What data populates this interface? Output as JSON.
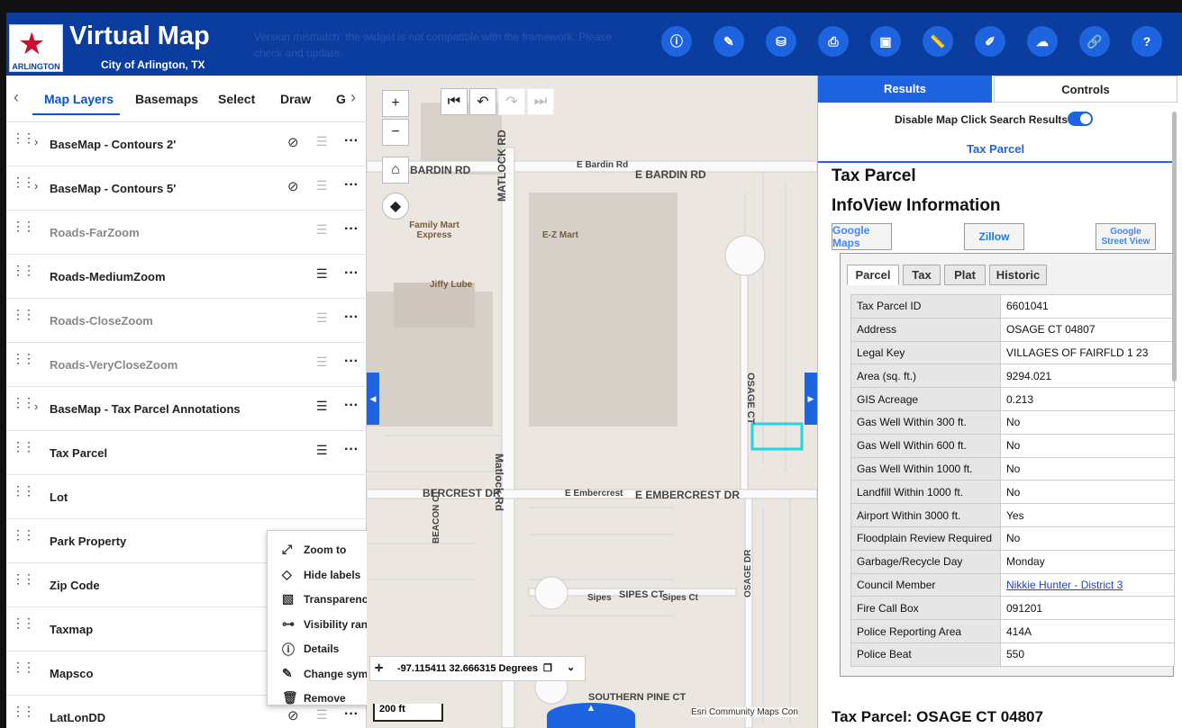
{
  "header": {
    "title": "Virtual Map",
    "subtitle": "City of Arlington, TX",
    "logo_text": "ARLINGTON",
    "version_message": "Version mismatch: the widget is not compatible with the framework. Please check and update.",
    "buttons": [
      "info-icon",
      "measure-icon",
      "data-icon",
      "print-icon",
      "bookmark-icon",
      "ruler-icon",
      "edit-icon",
      "cloud-icon",
      "link-icon",
      "help-icon"
    ]
  },
  "left": {
    "tabs": [
      "Map Layers",
      "Basemaps",
      "Select",
      "Draw",
      "G"
    ],
    "layers": [
      {
        "name": "BaseMap - Contours 2'",
        "expand": true,
        "eye": true,
        "legend": false,
        "dim": false
      },
      {
        "name": "BaseMap - Contours 5'",
        "expand": true,
        "eye": true,
        "legend": false,
        "dim": false
      },
      {
        "name": "Roads-FarZoom",
        "expand": false,
        "eye": false,
        "legend": false,
        "dim": true
      },
      {
        "name": "Roads-MediumZoom",
        "expand": false,
        "eye": false,
        "legend": true,
        "dim": false
      },
      {
        "name": "Roads-CloseZoom",
        "expand": false,
        "eye": false,
        "legend": false,
        "dim": true
      },
      {
        "name": "Roads-VeryCloseZoom",
        "expand": false,
        "eye": false,
        "legend": false,
        "dim": true
      },
      {
        "name": "BaseMap - Tax Parcel Annotations",
        "expand": true,
        "eye": false,
        "legend": true,
        "dim": false
      },
      {
        "name": "Tax Parcel",
        "expand": false,
        "eye": false,
        "legend": true,
        "dim": false
      },
      {
        "name": "Lot",
        "expand": false,
        "eye": false,
        "legend": false,
        "dim": false
      },
      {
        "name": "Park Property",
        "expand": false,
        "eye": false,
        "legend": false,
        "dim": false
      },
      {
        "name": "Zip Code",
        "expand": false,
        "eye": false,
        "legend": false,
        "dim": false
      },
      {
        "name": "Taxmap",
        "expand": false,
        "eye": false,
        "legend": false,
        "dim": false
      },
      {
        "name": "Mapsco",
        "expand": false,
        "eye": true,
        "legend": false,
        "dim": false
      },
      {
        "name": "LatLonDD",
        "expand": false,
        "eye": true,
        "legend": false,
        "dim": false
      }
    ],
    "context_menu": [
      "Zoom to",
      "Hide labels",
      "Transparency",
      "Visibility range",
      "Details",
      "Change symbol",
      "Remove"
    ]
  },
  "map": {
    "labels": [
      "BARDIN RD",
      "E Bardin Rd",
      "E BARDIN RD",
      "MATLOCK RD",
      "Matlock Rd",
      "BERCREST DR",
      "E Embercrest",
      "E EMBERCREST DR",
      "BEACON CT",
      "OSAGE CT",
      "OSAGE DR",
      "Sipes",
      "SIPES CT",
      "Sipes Ct",
      "SOUTHERN PINE CT"
    ],
    "pois": [
      "Family Mart Express",
      "E-Z Mart",
      "Jiffy Lube"
    ],
    "coordinates": "-97.115411 32.666315 Degrees",
    "scale": "200 ft",
    "attribution": "Esri Community Maps Con"
  },
  "right": {
    "tab_results": "Results",
    "tab_controls": "Controls",
    "disable_label": "Disable Map Click Search Results",
    "result_tab": "Tax Parcel",
    "title": "Tax Parcel",
    "infoview_title": "InfoView Information",
    "ext_buttons": [
      "Google Maps",
      "Zillow",
      "Google Street View"
    ],
    "parcel_tabs": [
      "Parcel",
      "Tax",
      "Plat",
      "Historic"
    ],
    "rows": [
      [
        "Tax Parcel ID",
        "6601041"
      ],
      [
        "Address",
        "OSAGE CT 04807"
      ],
      [
        "Legal Key",
        "VILLAGES OF FAIRFLD 1 23"
      ],
      [
        "Area (sq. ft.)",
        "9294.021"
      ],
      [
        "GIS Acreage",
        "0.213"
      ],
      [
        "Gas Well Within 300 ft.",
        "No"
      ],
      [
        "Gas Well Within 600 ft.",
        "No"
      ],
      [
        "Gas Well Within 1000 ft.",
        "No"
      ],
      [
        "Landfill Within 1000 ft.",
        "No"
      ],
      [
        "Airport Within 3000 ft.",
        "Yes"
      ],
      [
        "Floodplain Review Required",
        "No"
      ],
      [
        "Garbage/Recycle Day",
        "Monday"
      ],
      [
        "Council Member",
        "Nikkie Hunter - District 3"
      ],
      [
        "Fire Call Box",
        "091201"
      ],
      [
        "Police Reporting Area",
        "414A"
      ],
      [
        "Police Beat",
        "550"
      ]
    ],
    "bottom_title": "Tax Parcel: OSAGE CT 04807"
  }
}
